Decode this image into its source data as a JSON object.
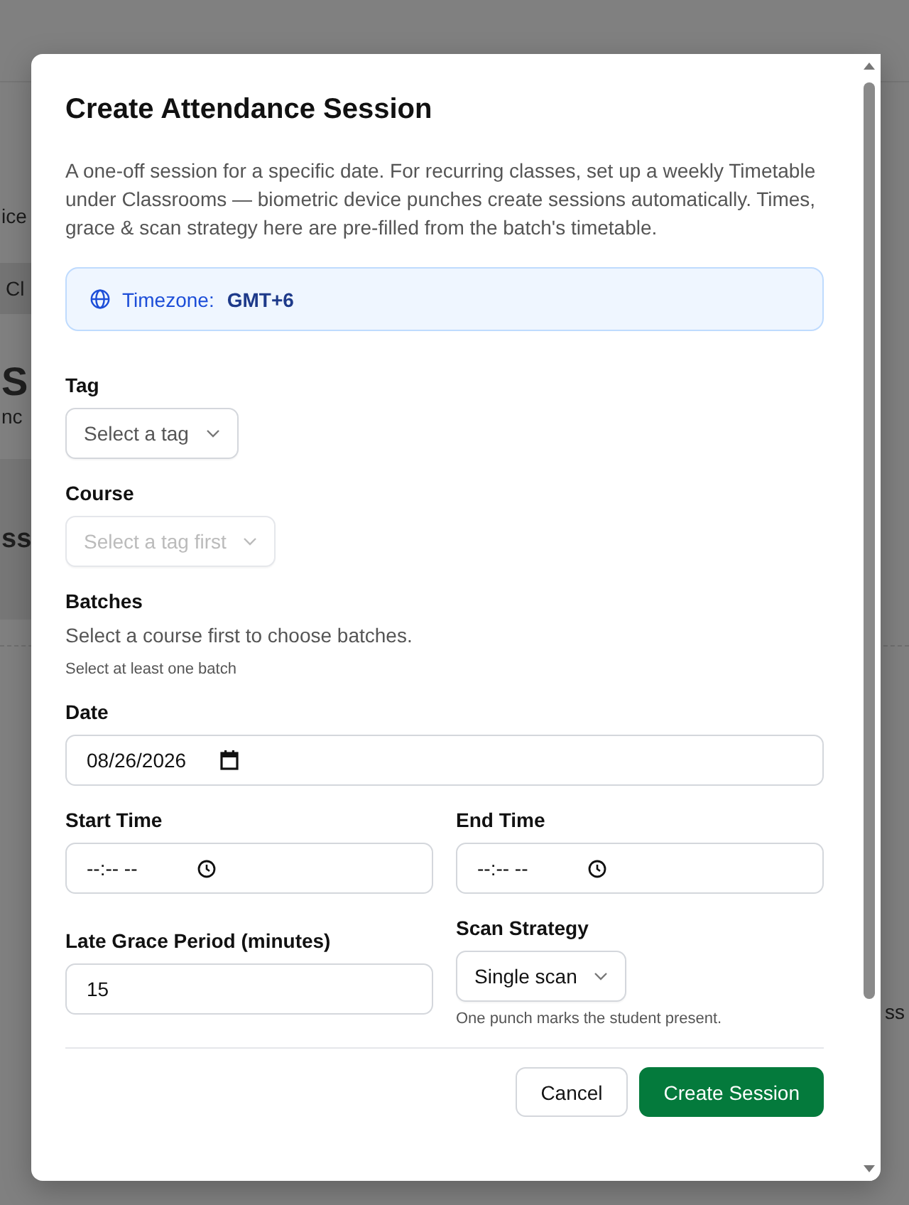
{
  "background": {
    "fragments": [
      {
        "kind": "text",
        "text": "ice"
      },
      {
        "kind": "chip",
        "text": "Cl"
      },
      {
        "kind": "heading",
        "text": "S"
      },
      {
        "kind": "text",
        "text": "nc"
      },
      {
        "kind": "subheading",
        "text": "ss"
      }
    ],
    "right_fragment": "ss"
  },
  "dialog": {
    "title": "Create Attendance Session",
    "description": "A one-off session for a specific date. For recurring classes, set up a weekly Timetable under Classrooms — biometric device punches create sessions automatically. Times, grace & scan strategy here are pre-filled from the batch's timetable.",
    "timezone": {
      "label": "Timezone:",
      "value": "GMT+6"
    },
    "rows": [
      [
        {
          "kind": "select",
          "label": "Tag",
          "placeholder": "Select a tag",
          "disabled": false
        }
      ],
      [
        {
          "kind": "select",
          "label": "Course",
          "placeholder": "Select a tag first",
          "disabled": true
        }
      ],
      [
        {
          "kind": "note",
          "label": "Batches",
          "text": "Select a course first to choose batches.",
          "hint": "Select at least one batch"
        }
      ],
      [
        {
          "kind": "date",
          "label": "Date",
          "value": "08/26/2026"
        }
      ],
      [
        {
          "kind": "time",
          "label": "Start Time",
          "value": "--:-- --"
        },
        {
          "kind": "time",
          "label": "End Time",
          "value": "--:-- --"
        }
      ],
      [
        {
          "kind": "input",
          "label": "Late Grace Period (minutes)",
          "value": "15"
        },
        {
          "kind": "select",
          "label": "Scan Strategy",
          "value": "Single scan",
          "disabled": false,
          "hint": "One punch marks the student present."
        }
      ]
    ],
    "buttons": [
      {
        "kind": "secondary",
        "label": "Cancel"
      },
      {
        "kind": "primary",
        "label": "Create Session"
      }
    ]
  }
}
